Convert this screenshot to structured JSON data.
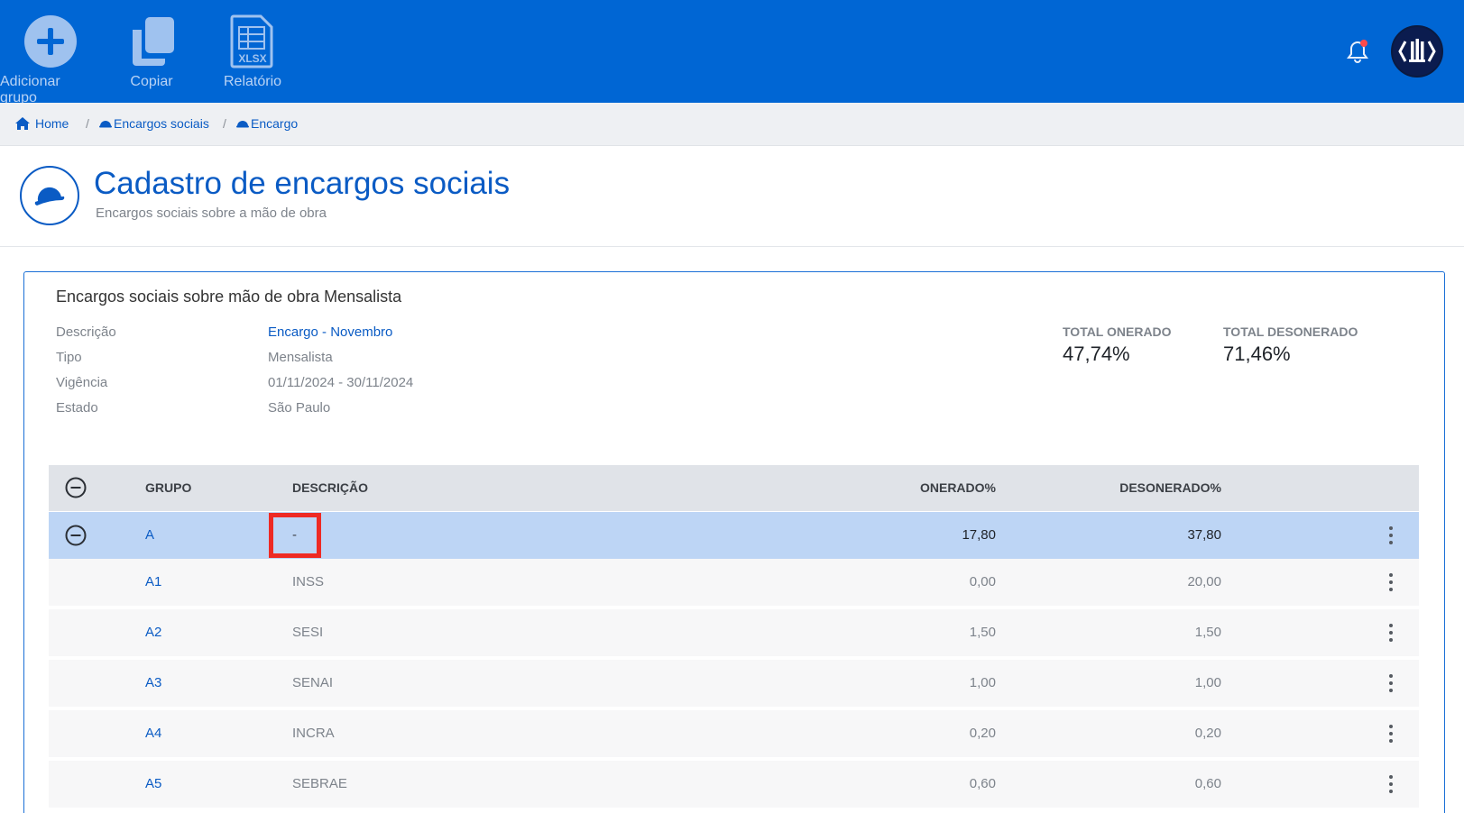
{
  "toolbar": {
    "add_group": "Adicionar grupo",
    "copy": "Copiar",
    "report": "Relatório",
    "report_icon_text": "XLSX"
  },
  "colors": {
    "primary": "#0066d4",
    "link": "#0a5bc4",
    "group_row": "#bdd5f5",
    "highlight": "#ee2a24"
  },
  "breadcrumb": {
    "home": "Home",
    "social_charges": "Encargos sociais",
    "charge": "Encargo",
    "separator": "/"
  },
  "page": {
    "title": "Cadastro de encargos sociais",
    "subtitle": "Encargos sociais sobre a mão de obra"
  },
  "card": {
    "title": "Encargos sociais sobre mão de obra Mensalista",
    "fields": {
      "description_label": "Descrição",
      "description_value": "Encargo - Novembro",
      "type_label": "Tipo",
      "type_value": "Mensalista",
      "validity_label": "Vigência",
      "validity_value": "01/11/2024 - 30/11/2024",
      "state_label": "Estado",
      "state_value": "São Paulo"
    },
    "totals": {
      "onerado_label": "TOTAL ONERADO",
      "onerado_value": "47,74%",
      "desonerado_label": "TOTAL DESONERADO",
      "desonerado_value": "71,46%"
    }
  },
  "table": {
    "headers": {
      "group": "GRUPO",
      "description": "DESCRIÇÃO",
      "onerado": "ONERADO%",
      "desonerado": "DESONERADO%"
    },
    "rows": [
      {
        "code": "A",
        "description": "-",
        "onerado": "17,80",
        "desonerado": "37,80"
      },
      {
        "code": "A1",
        "description": "INSS",
        "onerado": "0,00",
        "desonerado": "20,00"
      },
      {
        "code": "A2",
        "description": "SESI",
        "onerado": "1,50",
        "desonerado": "1,50"
      },
      {
        "code": "A3",
        "description": "SENAI",
        "onerado": "1,00",
        "desonerado": "1,00"
      },
      {
        "code": "A4",
        "description": "INCRA",
        "onerado": "0,20",
        "desonerado": "0,20"
      },
      {
        "code": "A5",
        "description": "SEBRAE",
        "onerado": "0,60",
        "desonerado": "0,60"
      }
    ]
  }
}
